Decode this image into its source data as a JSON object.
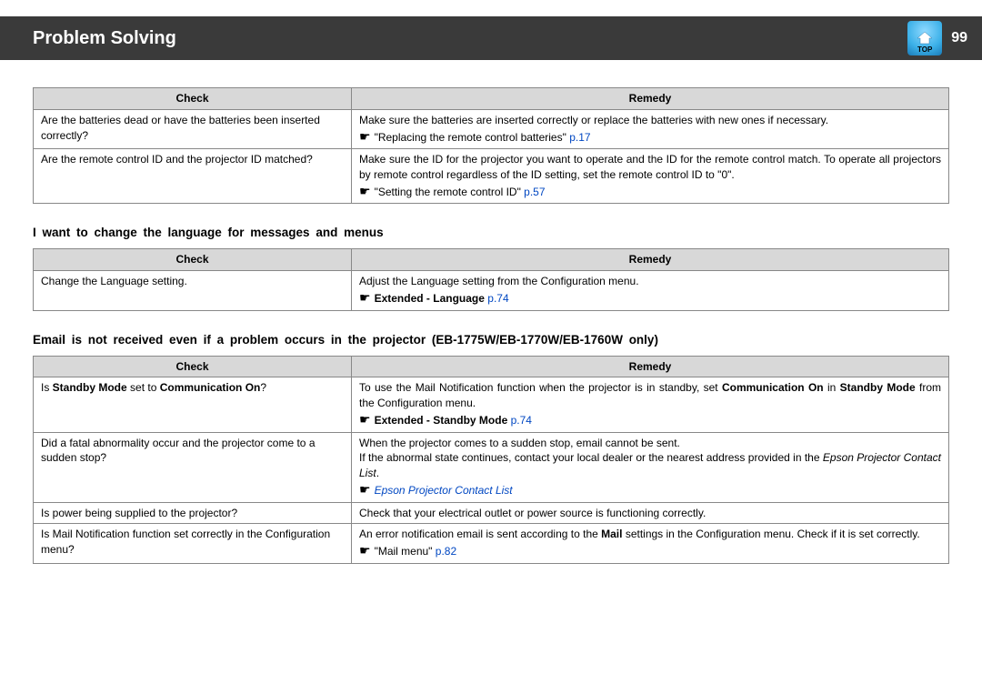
{
  "header": {
    "title": "Problem Solving",
    "top_label": "TOP",
    "page_number": "99"
  },
  "columns": {
    "check": "Check",
    "remedy": "Remedy"
  },
  "tables": {
    "t1": {
      "rows": [
        {
          "check": "Are the batteries dead or have the batteries been inserted correctly?",
          "remedy_text": "Make sure the batteries are inserted correctly or replace the batteries with new ones if necessary.",
          "ref_text": "\"Replacing the remote control batteries\"",
          "ref_page": "p.17"
        },
        {
          "check": "Are the remote control ID and the projector ID matched?",
          "remedy_text": "Make sure the ID for the projector you want to operate and the ID for the remote control match. To operate all projectors by remote control regardless of the ID setting, set the remote control ID to \"0\".",
          "ref_text": "\"Setting the remote control ID\"",
          "ref_page": "p.57"
        }
      ]
    },
    "t2": {
      "heading": "I want to change the language for messages and menus",
      "rows": [
        {
          "check": "Change  the  Language  setting.",
          "remedy_text": "Adjust  the  Language  setting  from  the  Configuration  menu.",
          "ref_bold": "Extended  -  Language",
          "ref_page": "p.74"
        }
      ]
    },
    "t3": {
      "heading": "Email  is  not  received  even  if  a  problem  occurs  in  the  projector  (EB-1775W/EB-1770W/EB-1760W  only)",
      "rows": [
        {
          "check_pre": "Is ",
          "check_bold1": "Standby Mode",
          "check_mid": " set to ",
          "check_bold2": "Communication On",
          "check_post": "?",
          "remedy_pre": "To use the Mail Notification function when the projector is in standby, set ",
          "remedy_bold1": "Communication On",
          "remedy_mid": " in ",
          "remedy_bold2": "Standby Mode",
          "remedy_post": " from the Configuration menu.",
          "ref_bold": "Extended - Standby Mode",
          "ref_page": "p.74"
        },
        {
          "check": "Did a fatal abnormality occur and the projector come to a sudden stop?",
          "remedy_line1": "When the projector comes to a sudden stop, email cannot be sent.",
          "remedy_line2_pre": "If the abnormal state continues, contact your local dealer or the nearest address provided in the ",
          "remedy_line2_italic": "Epson Projector Contact List",
          "remedy_line2_post": ".",
          "ref_link": "Epson Projector Contact List"
        },
        {
          "check": "Is power being supplied to the projector?",
          "remedy_text": "Check that your electrical outlet or power source is functioning correctly."
        },
        {
          "check": "Is Mail Notification function set correctly in the Configuration menu?",
          "remedy_pre": "An error notification email is sent according to the ",
          "remedy_bold": "Mail",
          "remedy_post": " settings in the Configuration menu. Check if it is set correctly.",
          "ref_text": "\"Mail menu\"",
          "ref_page": "p.82"
        }
      ]
    }
  }
}
